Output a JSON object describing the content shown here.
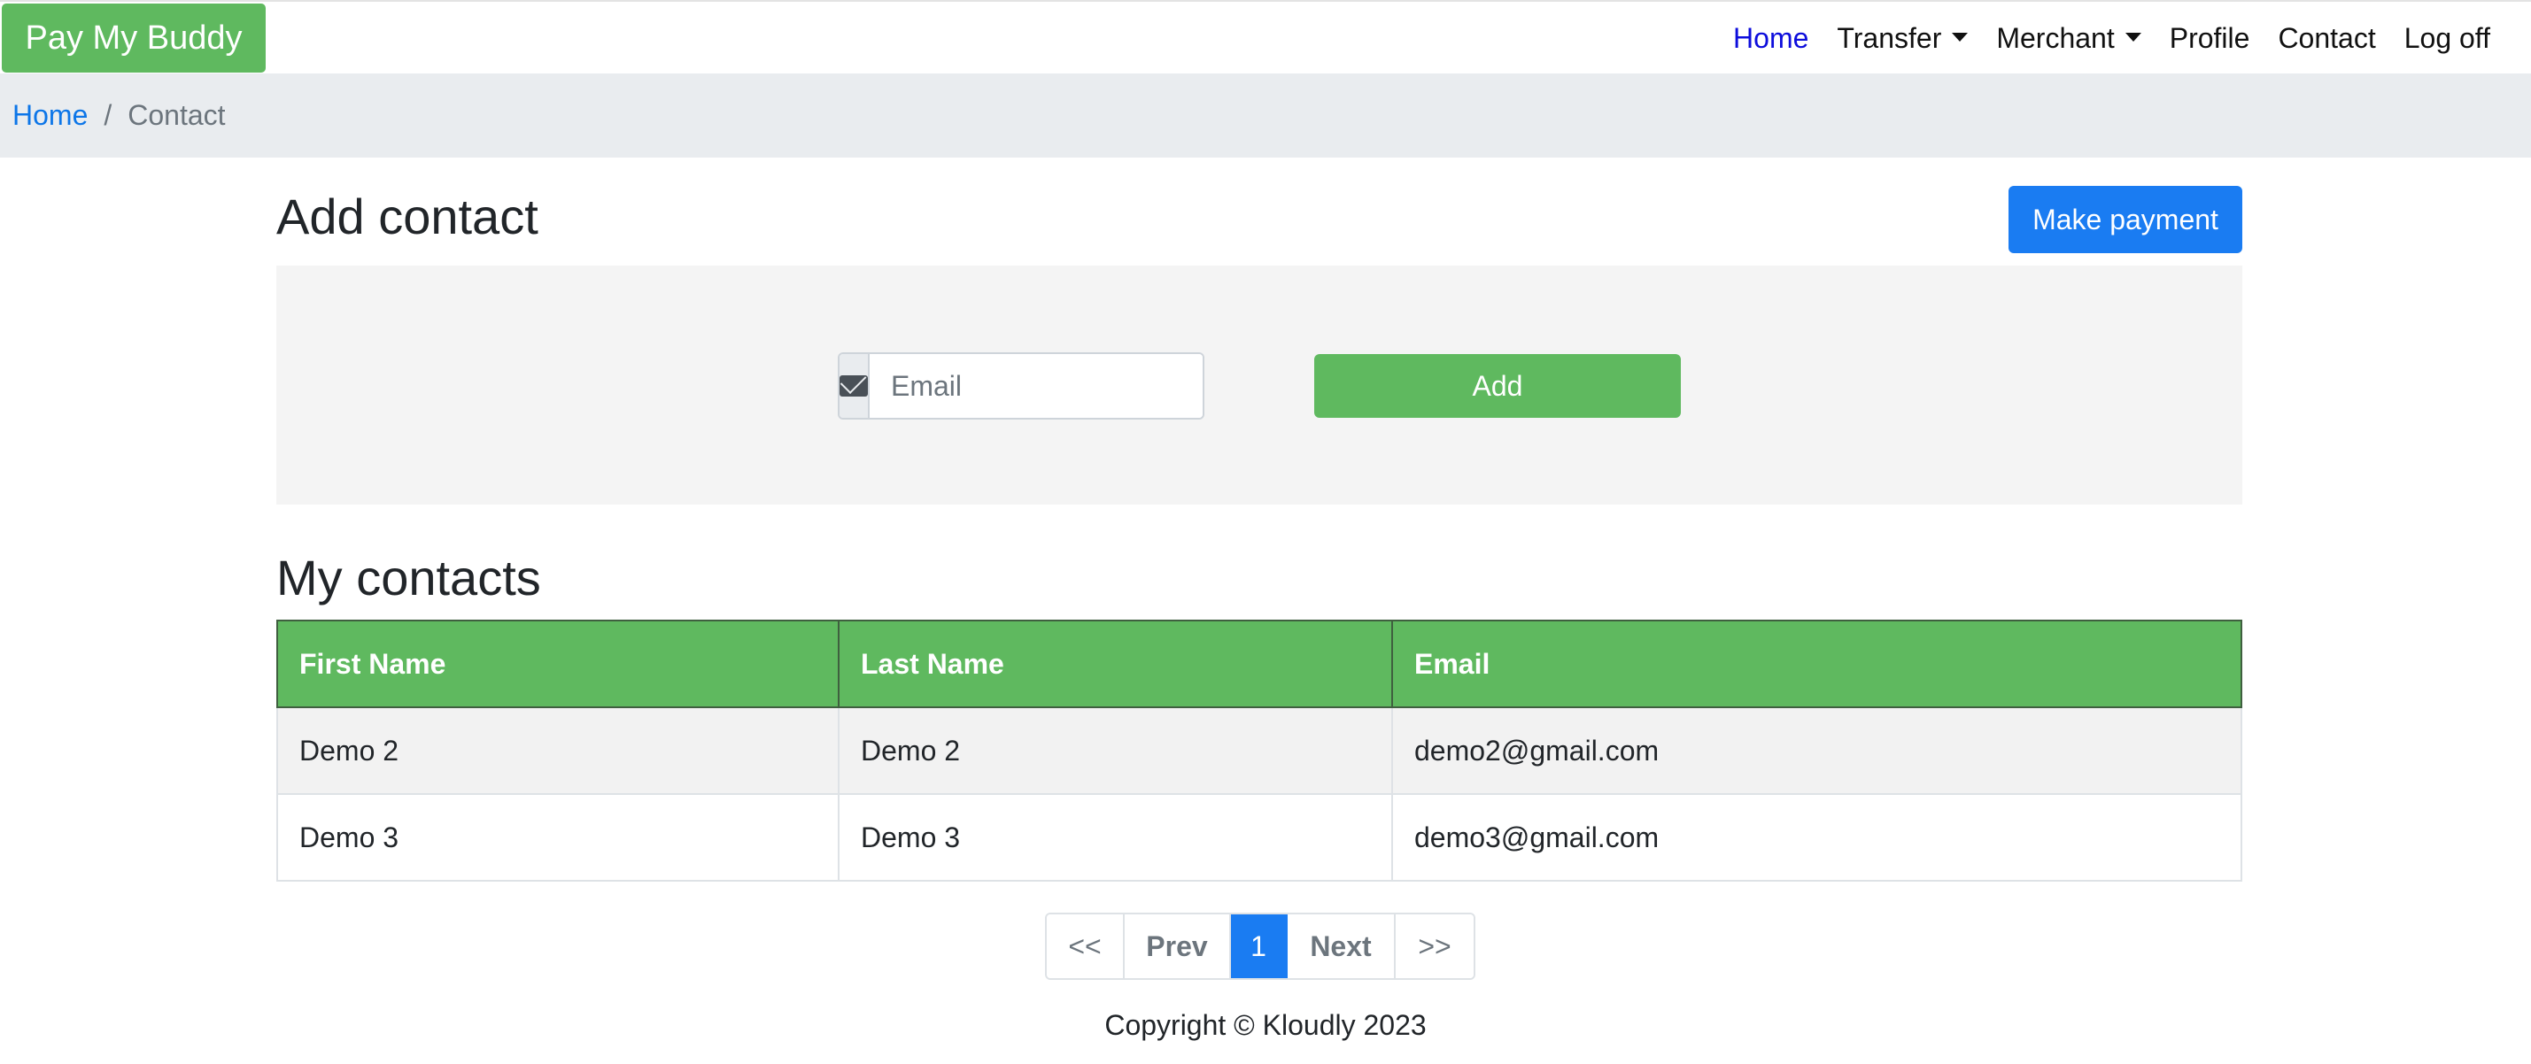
{
  "brand": "Pay My Buddy",
  "nav": {
    "home": "Home",
    "transfer": "Transfer",
    "merchant": "Merchant",
    "profile": "Profile",
    "contact": "Contact",
    "logoff": "Log off"
  },
  "breadcrumb": {
    "home": "Home",
    "separator": "/",
    "current": "Contact"
  },
  "add_contact": {
    "title": "Add contact",
    "make_payment_label": "Make payment",
    "email_placeholder": "Email",
    "email_icon": "envelope-icon",
    "add_label": "Add"
  },
  "contacts": {
    "title": "My contacts",
    "columns": [
      "First Name",
      "Last Name",
      "Email"
    ],
    "rows": [
      {
        "first": "Demo 2",
        "last": "Demo 2",
        "email": "demo2@gmail.com"
      },
      {
        "first": "Demo 3",
        "last": "Demo 3",
        "email": "demo3@gmail.com"
      }
    ]
  },
  "pagination": {
    "first": "<<",
    "prev": "Prev",
    "current": "1",
    "next": "Next",
    "last": ">>"
  },
  "footer": "Copyright © Kloudly 2023",
  "colors": {
    "brand_green": "#5fb95f",
    "primary_blue": "#1a7cf2",
    "active_nav": "#0d0ddc"
  }
}
